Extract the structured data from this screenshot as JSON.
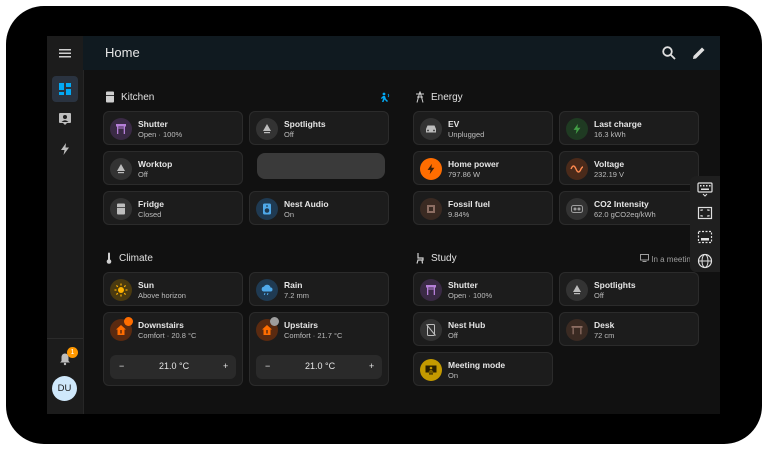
{
  "app": {
    "title": "Home"
  },
  "user": {
    "initials": "DU"
  },
  "notifications": {
    "count": "1"
  },
  "sections": {
    "kitchen": {
      "title": "Kitchen"
    },
    "energy": {
      "title": "Energy"
    },
    "climate": {
      "title": "Climate"
    },
    "study": {
      "title": "Study",
      "badge": "In a meeting"
    }
  },
  "kitchen_cards": [
    {
      "name": "Shutter",
      "state": "Open · 100%"
    },
    {
      "name": "Spotlights",
      "state": "Off"
    },
    {
      "name": "Worktop",
      "state": "Off"
    },
    {
      "name": "Fridge",
      "state": "Closed"
    },
    {
      "name": "Nest Audio",
      "state": "On"
    }
  ],
  "energy_cards": [
    {
      "name": "EV",
      "state": "Unplugged"
    },
    {
      "name": "Last charge",
      "state": "16.3 kWh"
    },
    {
      "name": "Home power",
      "state": "797.86 W"
    },
    {
      "name": "Voltage",
      "state": "232.19 V"
    },
    {
      "name": "Fossil fuel",
      "state": "9.84%"
    },
    {
      "name": "CO2 Intensity",
      "state": "62.0 gCO2eq/kWh"
    }
  ],
  "climate_cards": [
    {
      "name": "Sun",
      "state": "Above horizon"
    },
    {
      "name": "Rain",
      "state": "7.2 mm"
    }
  ],
  "thermostats": [
    {
      "name": "Downstairs",
      "state": "Comfort · 20.8 °C",
      "target": "21.0 °C"
    },
    {
      "name": "Upstairs",
      "state": "Comfort · 21.7 °C",
      "target": "21.0 °C"
    }
  ],
  "study_cards": [
    {
      "name": "Shutter",
      "state": "Open · 100%"
    },
    {
      "name": "Spotlights",
      "state": "Off"
    },
    {
      "name": "Nest Hub",
      "state": "Off"
    },
    {
      "name": "Desk",
      "state": "72 cm"
    },
    {
      "name": "Meeting mode",
      "state": "On"
    }
  ],
  "stepper": {
    "minus": "−",
    "plus": "+"
  },
  "colors": {
    "accent": "#03a9f4",
    "shutter": "#8e44ad",
    "power": "#ff6d00",
    "voltage": "#ff8a50",
    "green": "#43a047",
    "thermostat": "#e65100",
    "sun": "#ffb300",
    "meeting": "#c49a00"
  }
}
